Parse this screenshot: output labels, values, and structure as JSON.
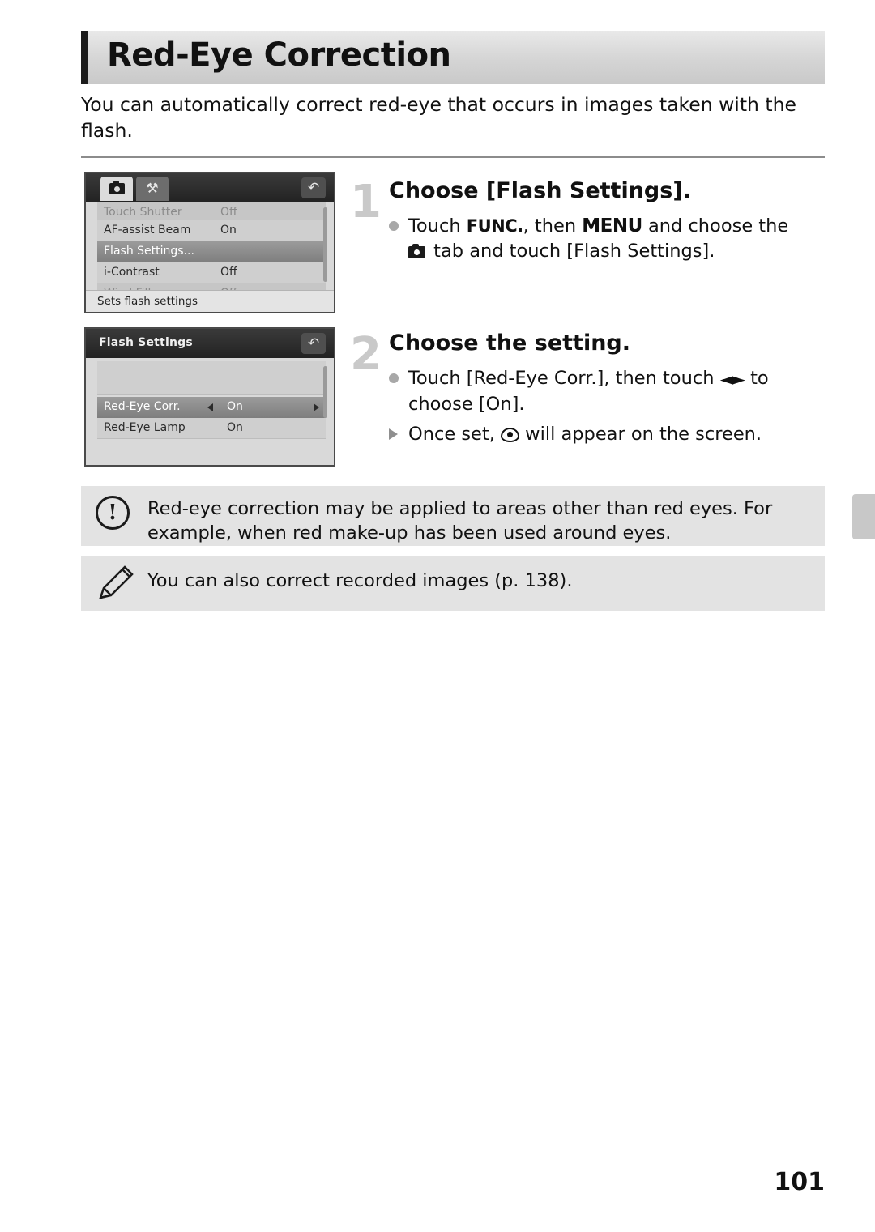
{
  "document": {
    "title": "Red-Eye Correction",
    "intro": "You can automatically correct red-eye that occurs in images taken with the flash.",
    "page_number": "101"
  },
  "screens": {
    "screen1": {
      "tabs": [
        "camera-tab",
        "wrench-tab"
      ],
      "back_label": "↶",
      "rows": [
        {
          "label": "Touch Shutter",
          "value": "Off",
          "state": "faded-top"
        },
        {
          "label": "AF-assist Beam",
          "value": "On",
          "state": "normal"
        },
        {
          "label": "Flash Settings...",
          "value": "",
          "state": "selected"
        },
        {
          "label": "i-Contrast",
          "value": "Off",
          "state": "normal"
        },
        {
          "label": "Wind Filter",
          "value": "Off",
          "state": "faded-bottom"
        }
      ],
      "footer": "Sets flash settings"
    },
    "screen2": {
      "title": "Flash Settings",
      "back_label": "↶",
      "rows": [
        {
          "label": "Red-Eye Corr.",
          "value": "On",
          "state": "selected"
        },
        {
          "label": "Red-Eye Lamp",
          "value": "On",
          "state": "normal"
        }
      ]
    }
  },
  "steps": [
    {
      "number": "1",
      "heading": "Choose [Flash Settings].",
      "body_1_pre": "Touch ",
      "body_1_func": "FUNC.",
      "body_1_mid": ", then ",
      "body_1_menu": "MENU",
      "body_1_post": " and choose the",
      "body_2_post": " tab and touch [Flash Settings]."
    },
    {
      "number": "2",
      "heading": "Choose the setting.",
      "body_1_pre": "Touch [Red-Eye Corr.], then touch ",
      "body_1_arrows": "◄►",
      "body_1_post": " to choose [On].",
      "body_2_pre": "Once set, ",
      "body_2_post": " will appear on the screen."
    }
  ],
  "notices": [
    {
      "icon": "exclamation-icon",
      "text": "Red-eye correction may be applied to areas other than red eyes. For example, when red make-up has been used around eyes."
    },
    {
      "icon": "pencil-icon",
      "text": "You can also correct recorded images (p. 138)."
    }
  ]
}
